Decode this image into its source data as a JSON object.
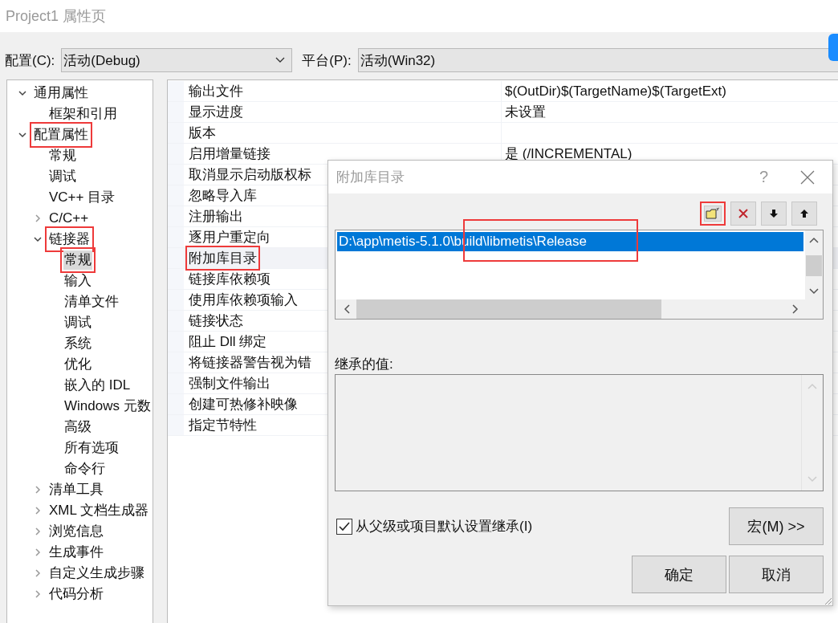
{
  "window": {
    "title": "Project1 属性页"
  },
  "config": {
    "label": "配置(C):",
    "value": "活动(Debug)"
  },
  "platform": {
    "label": "平台(P):",
    "value": "活动(Win32)"
  },
  "tree": [
    {
      "label": "通用属性",
      "expanded": true,
      "selected": false,
      "annotated": false,
      "children": [
        {
          "label": "框架和引用",
          "selected": false,
          "annotated": false
        }
      ]
    },
    {
      "label": "配置属性",
      "expanded": true,
      "selected": false,
      "annotated": true,
      "children": [
        {
          "label": "常规",
          "selected": false,
          "annotated": false
        },
        {
          "label": "调试",
          "selected": false,
          "annotated": false
        },
        {
          "label": "VC++ 目录",
          "selected": false,
          "annotated": false
        },
        {
          "label": "C/C++",
          "expanded": false,
          "selected": false,
          "annotated": false
        },
        {
          "label": "链接器",
          "expanded": true,
          "selected": false,
          "annotated": true,
          "children": [
            {
              "label": "常规",
              "selected": true,
              "annotated": true
            },
            {
              "label": "输入",
              "selected": false,
              "annotated": false
            },
            {
              "label": "清单文件",
              "selected": false,
              "annotated": false
            },
            {
              "label": "调试",
              "selected": false,
              "annotated": false
            },
            {
              "label": "系统",
              "selected": false,
              "annotated": false
            },
            {
              "label": "优化",
              "selected": false,
              "annotated": false
            },
            {
              "label": "嵌入的 IDL",
              "selected": false,
              "annotated": false
            },
            {
              "label": "Windows 元数",
              "selected": false,
              "annotated": false
            },
            {
              "label": "高级",
              "selected": false,
              "annotated": false
            },
            {
              "label": "所有选项",
              "selected": false,
              "annotated": false
            },
            {
              "label": "命令行",
              "selected": false,
              "annotated": false
            }
          ]
        },
        {
          "label": "清单工具",
          "expanded": false,
          "selected": false,
          "annotated": false
        },
        {
          "label": "XML 文档生成器",
          "expanded": false,
          "selected": false,
          "annotated": false
        },
        {
          "label": "浏览信息",
          "expanded": false,
          "selected": false,
          "annotated": false
        },
        {
          "label": "生成事件",
          "expanded": false,
          "selected": false,
          "annotated": false
        },
        {
          "label": "自定义生成步骤",
          "expanded": false,
          "selected": false,
          "annotated": false
        },
        {
          "label": "代码分析",
          "expanded": false,
          "selected": false,
          "annotated": false
        }
      ]
    }
  ],
  "properties": [
    {
      "name": "输出文件",
      "value": "$(OutDir)$(TargetName)$(TargetExt)",
      "selected": false,
      "annotated": false
    },
    {
      "name": "显示进度",
      "value": "未设置",
      "selected": false,
      "annotated": false
    },
    {
      "name": "版本",
      "selected": false,
      "annotated": false
    },
    {
      "name": "启用增量链接",
      "value": "是 (/INCREMENTAL)",
      "selected": false,
      "annotated": false
    },
    {
      "name": "取消显示启动版权标",
      "selected": false,
      "annotated": false
    },
    {
      "name": "忽略导入库",
      "selected": false,
      "annotated": false
    },
    {
      "name": "注册输出",
      "selected": false,
      "annotated": false
    },
    {
      "name": "逐用户重定向",
      "selected": false,
      "annotated": false
    },
    {
      "name": "附加库目录",
      "selected": true,
      "annotated": true
    },
    {
      "name": "链接库依赖项",
      "selected": false,
      "annotated": false
    },
    {
      "name": "使用库依赖项输入",
      "selected": false,
      "annotated": false
    },
    {
      "name": "链接状态",
      "selected": false,
      "annotated": false
    },
    {
      "name": "阻止 Dll 绑定",
      "selected": false,
      "annotated": false
    },
    {
      "name": "将链接器警告视为错",
      "selected": false,
      "annotated": false
    },
    {
      "name": "强制文件输出",
      "selected": false,
      "annotated": false
    },
    {
      "name": "创建可热修补映像",
      "selected": false,
      "annotated": false
    },
    {
      "name": "指定节特性",
      "selected": false,
      "annotated": false
    }
  ],
  "dialog": {
    "title": "附加库目录",
    "help": "?",
    "toolbar": [
      {
        "kind": "new-folder",
        "annotated": true
      },
      {
        "kind": "delete",
        "annotated": false
      },
      {
        "kind": "move-down",
        "annotated": false
      },
      {
        "kind": "move-up",
        "annotated": false
      }
    ],
    "entries": [
      {
        "text": "D:\\app\\metis-5.1.0\\build\\libmetis\\Release",
        "selected": true,
        "annotated": true
      }
    ],
    "inherited_label": "继承的值:",
    "inherit": {
      "label": "从父级或项目默认设置继承(I)",
      "checked": true
    },
    "macro_button": "宏(M) >>",
    "buttons": [
      "确定",
      "取消"
    ]
  }
}
